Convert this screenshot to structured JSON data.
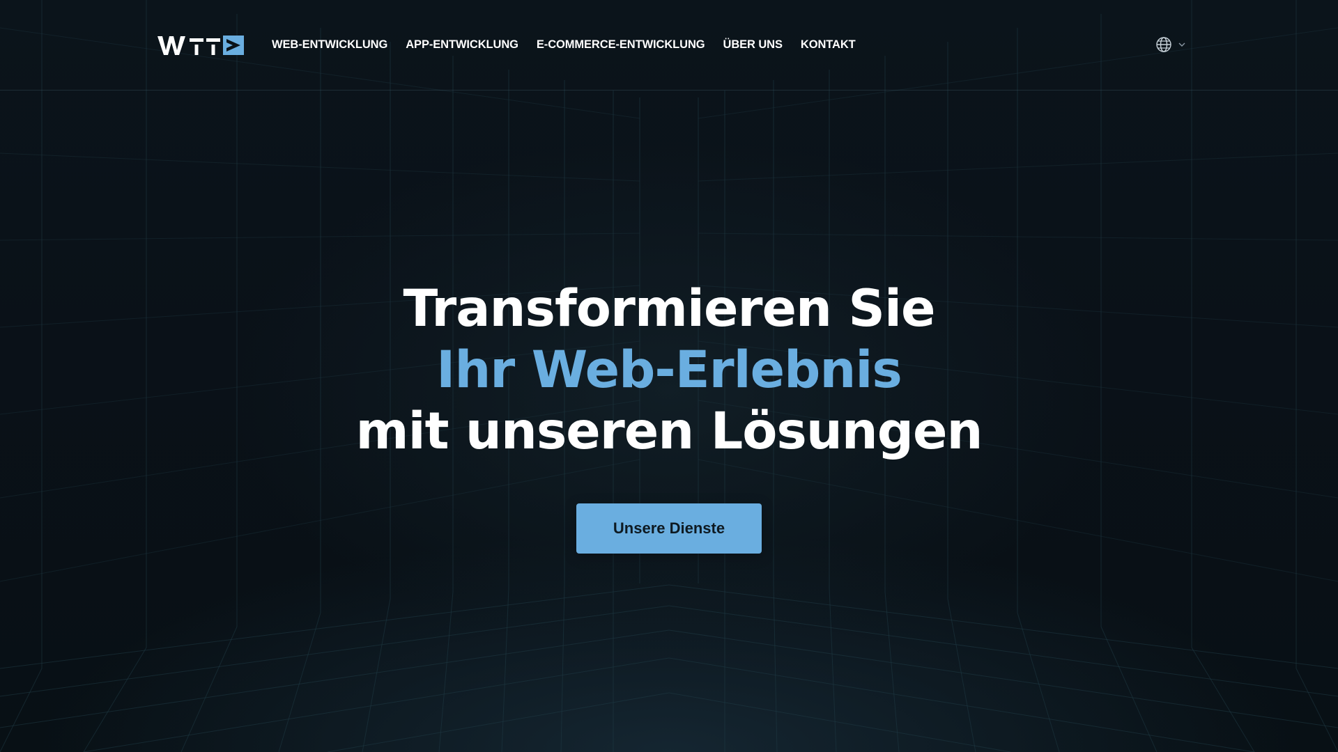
{
  "header": {
    "logo": {
      "text": "WTT",
      "icon": "play-chevron-icon",
      "accent_color": "#6aaee0"
    },
    "nav": [
      {
        "label": "WEB-ENTWICKLUNG"
      },
      {
        "label": "APP-ENTWICKLUNG"
      },
      {
        "label": "E-COMMERCE-ENTWICKLUNG"
      },
      {
        "label": "ÜBER UNS"
      },
      {
        "label": "KONTAKT"
      }
    ],
    "language_switcher": {
      "icon": "globe-icon",
      "chevron": "chevron-down-icon"
    }
  },
  "hero": {
    "line1": "Transformieren Sie",
    "line2": "Ihr Web-Erlebnis",
    "line3": "mit unseren Lösungen",
    "cta_label": "Unsere Dienste"
  },
  "colors": {
    "background": "#0a1218",
    "accent": "#6aaee0",
    "text": "#ffffff",
    "grid": "#1f3a44"
  }
}
